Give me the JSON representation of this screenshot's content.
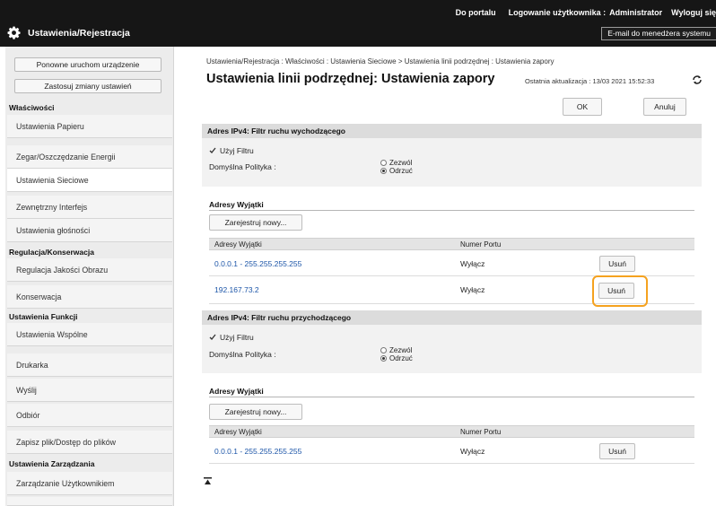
{
  "header": {
    "links": [
      "Do portalu",
      "Logowanie użytkownika :",
      "Administrator",
      "Wyloguj się"
    ],
    "app_title": "Ustawienia/Rejestracja",
    "email_link": "E-mail do menedżera systemu"
  },
  "sidebar": {
    "buttons": [
      "Ponowne uruchom urządzenie",
      "Zastosuj zmiany ustawień"
    ],
    "groups": [
      {
        "title": "Właściwości",
        "items": [
          "Ustawienia Papieru",
          "Zegar/Oszczędzanie Energii",
          "Ustawienia Sieciowe",
          "Zewnętrzny Interfejs",
          "Ustawienia głośności"
        ]
      },
      {
        "title": "Regulacja/Konserwacja",
        "items": [
          "Regulacja Jakości Obrazu",
          "Konserwacja"
        ]
      },
      {
        "title": "Ustawienia Funkcji",
        "items": [
          "Ustawienia Wspólne",
          "Drukarka",
          "Wyślij",
          "Odbiór",
          "Zapisz plik/Dostęp do plików"
        ]
      },
      {
        "title": "Ustawienia Zarządzania",
        "items": [
          "Zarządzanie Użytkownikiem"
        ]
      }
    ],
    "active_item": "Ustawienia Sieciowe"
  },
  "main": {
    "breadcrumb": "Ustawienia/Rejestracja : Właściwości : Ustawienia Sieciowe > Ustawienia linii podrzędnej : Ustawienia zapory",
    "title": "Ustawienia linii podrzędnej: Ustawienia zapory",
    "last_update": "Ostatnia aktualizacja : 13/03 2021 15:52:33",
    "ok_label": "OK",
    "cancel_label": "Anuluj",
    "outgoing": {
      "header": "Adres IPv4: Filtr ruchu wychodzącego",
      "use_filter": "Użyj Filtru",
      "policy_label": "Domyślna Polityka :",
      "allow": "Zezwól",
      "deny": "Odrzuć",
      "exceptions_title": "Adresy Wyjątki",
      "register_new": "Zarejestruj nowy...",
      "col_address": "Adresy Wyjątki",
      "col_port": "Numer Portu",
      "rows": [
        {
          "address": "0.0.0.1 - 255.255.255.255",
          "port": "Wyłącz",
          "action": "Usuń"
        },
        {
          "address": "192.167.73.2",
          "port": "Wyłącz",
          "action": "Usuń"
        }
      ]
    },
    "incoming": {
      "header": "Adres IPv4: Filtr ruchu przychodzącego",
      "use_filter": "Użyj Filtru",
      "policy_label": "Domyślna Polityka :",
      "allow": "Zezwól",
      "deny": "Odrzuć",
      "exceptions_title": "Adresy Wyjątki",
      "register_new": "Zarejestruj nowy...",
      "col_address": "Adresy Wyjątki",
      "col_port": "Numer Portu",
      "rows": [
        {
          "address": "0.0.0.1 - 255.255.255.255",
          "port": "Wyłącz",
          "action": "Usuń"
        }
      ]
    }
  },
  "colors": {
    "highlight": "#f5a21f",
    "link": "#1c55a8",
    "header_bg": "#161616"
  }
}
